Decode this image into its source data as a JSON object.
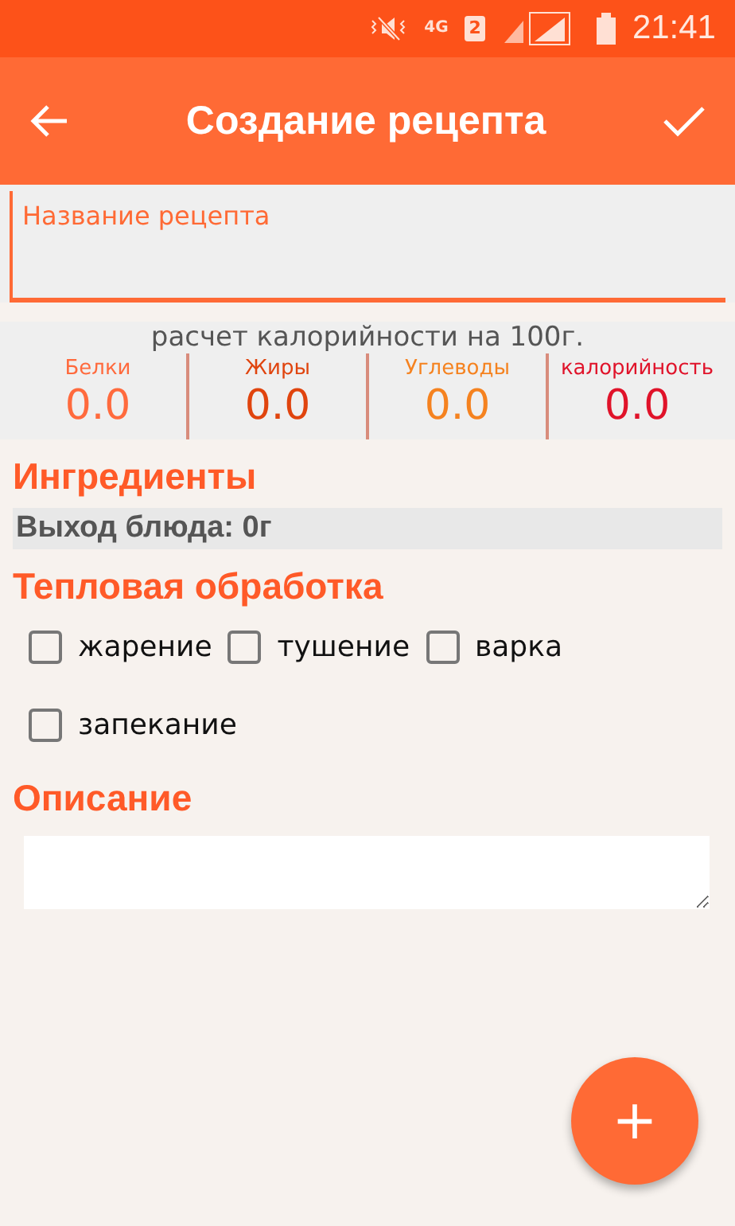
{
  "status_bar": {
    "network": "4G",
    "sim": "2",
    "time": "21:41"
  },
  "app_bar": {
    "title": "Создание рецепта"
  },
  "recipe_name": {
    "placeholder": "Название рецепта"
  },
  "nutrition": {
    "caption": "расчет калорийности на 100г.",
    "items": [
      {
        "label": "Белки",
        "value": "0.0",
        "color": "#ff6a3d"
      },
      {
        "label": "Жиры",
        "value": "0.0",
        "color": "#e0440e"
      },
      {
        "label": "Углеводы",
        "value": "0.0",
        "color": "#f5821f"
      },
      {
        "label": "калорийность",
        "value": "0.0",
        "color": "#e0132a"
      }
    ]
  },
  "ingredients": {
    "title": "Ингредиенты",
    "yield": "Выход блюда: 0г"
  },
  "heat_treatment": {
    "title": "Тепловая обработка",
    "options": [
      {
        "label": "жарение",
        "checked": false
      },
      {
        "label": "тушение",
        "checked": false
      },
      {
        "label": "варка",
        "checked": false
      },
      {
        "label": "запекание",
        "checked": false
      }
    ]
  },
  "description": {
    "title": "Описание"
  },
  "fab": {
    "label": "+"
  }
}
